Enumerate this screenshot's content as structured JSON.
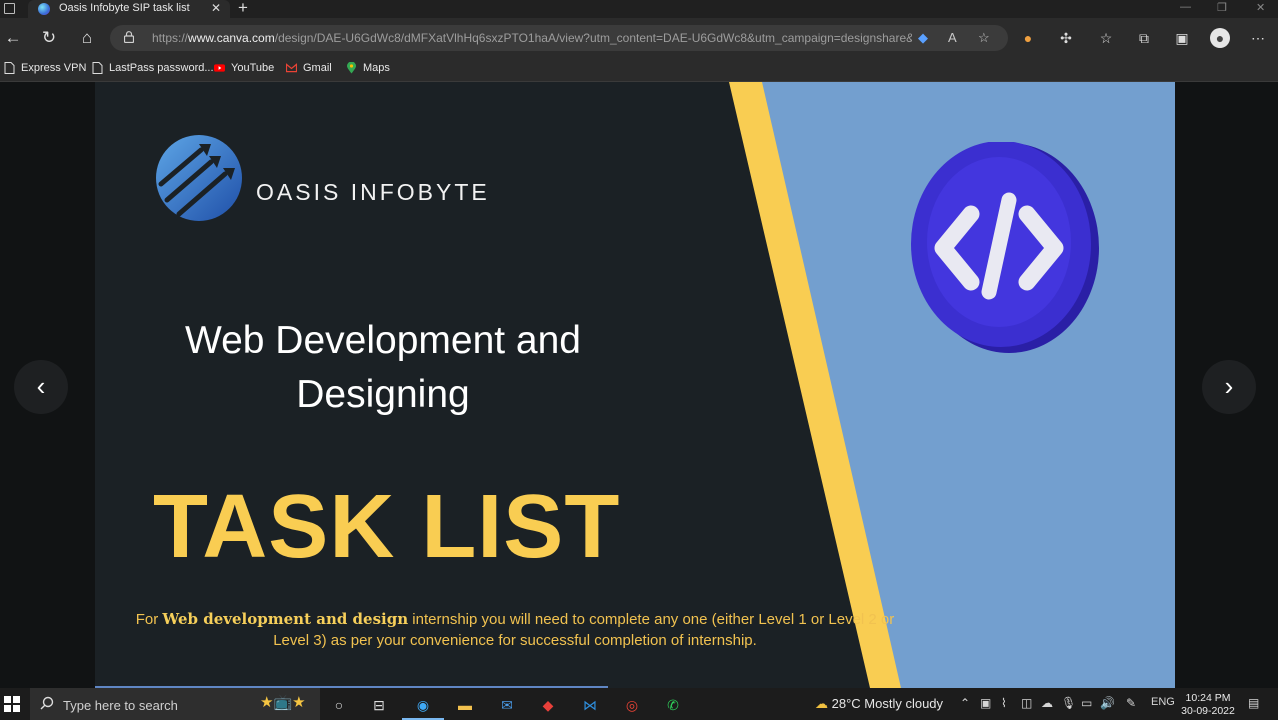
{
  "browser": {
    "tab_title": "Oasis Infobyte SIP task list",
    "url_prefix": "https://",
    "url_host": "www.canva.com",
    "url_rest": "/design/DAE-U6GdWc8/dMFXatVlhHq6sxzPTO1haA/view?utm_content=DAE-U6GdWc8&utm_campaign=designshare&u...",
    "bookmarks": [
      {
        "label": "Express VPN"
      },
      {
        "label": "LastPass password..."
      },
      {
        "label": "YouTube"
      },
      {
        "label": "Gmail"
      },
      {
        "label": "Maps"
      }
    ]
  },
  "slide": {
    "logo_text": "OASIS INFOBYTE",
    "headline_line1": "Web Development and",
    "headline_line2": "Designing",
    "big_title": "TASK LIST",
    "note_prefix": "For ",
    "note_bold": "Web development and design",
    "note_rest": " internship you will need to complete any one (either Level 1 or Level 2 or Level 3) as per your convenience for successful completion of internship.",
    "colors": {
      "background": "#1b2125",
      "accent_yellow": "#f9cd52",
      "panel_blue": "#739fcf",
      "coin_purple": "#3b2fd0"
    },
    "progress": 0.475
  },
  "taskbar": {
    "search_placeholder": "Type here to search",
    "weather": "28°C  Mostly cloudy",
    "language": "ENG",
    "time": "10:24 PM",
    "date": "30-09-2022"
  }
}
